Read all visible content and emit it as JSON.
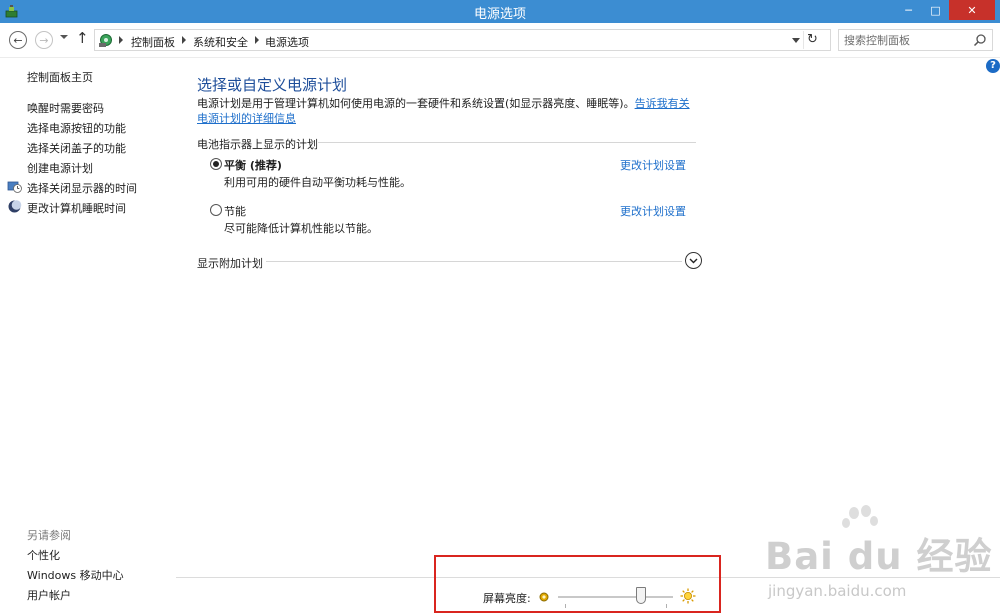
{
  "window": {
    "title": "电源选项",
    "controls": {
      "minimize": "─",
      "maximize": "□",
      "close": "✕"
    }
  },
  "address_bar": {
    "back_glyph": "←",
    "forward_glyph": "→",
    "up_glyph": "↑",
    "refresh_glyph": "↻",
    "breadcrumbs": [
      "控制面板",
      "系统和安全",
      "电源选项"
    ],
    "search_placeholder": "搜索控制面板"
  },
  "help_glyph": "?",
  "sidebar": {
    "home": "控制面板主页",
    "items": [
      {
        "label": "唤醒时需要密码",
        "icon": ""
      },
      {
        "label": "选择电源按钮的功能",
        "icon": ""
      },
      {
        "label": "选择关闭盖子的功能",
        "icon": ""
      },
      {
        "label": "创建电源计划",
        "icon": ""
      },
      {
        "label": "选择关闭显示器的时间",
        "icon": "monitor-clock-icon"
      },
      {
        "label": "更改计算机睡眠时间",
        "icon": "moon-icon"
      }
    ],
    "see_also": {
      "heading": "另请参阅",
      "items": [
        "个性化",
        "Windows 移动中心",
        "用户帐户"
      ]
    }
  },
  "main": {
    "title": "选择或自定义电源计划",
    "description": "电源计划是用于管理计算机如何使用电源的一套硬件和系统设置(如显示器亮度、睡眠等)。",
    "description_link": "告诉我有关电源计划的详细信息",
    "battery_section": "电池指示器上显示的计划",
    "plans": [
      {
        "name": "平衡 (推荐)",
        "description": "利用可用的硬件自动平衡功耗与性能。",
        "selected": true,
        "link": "更改计划设置"
      },
      {
        "name": "节能",
        "description": "尽可能降低计算机性能以节能。",
        "selected": false,
        "link": "更改计划设置"
      }
    ],
    "additional_section": "显示附加计划"
  },
  "brightness": {
    "label": "屏幕亮度:",
    "level_percent": 75
  },
  "colors": {
    "titlebar": "#3c8dd2",
    "close_button": "#c7312a",
    "heading": "#1e4e9a",
    "link": "#1e6fcb",
    "highlight": "#d9251f"
  },
  "watermark": {
    "text": "Bai du 经验",
    "sub": "jingyan.baidu.com"
  }
}
